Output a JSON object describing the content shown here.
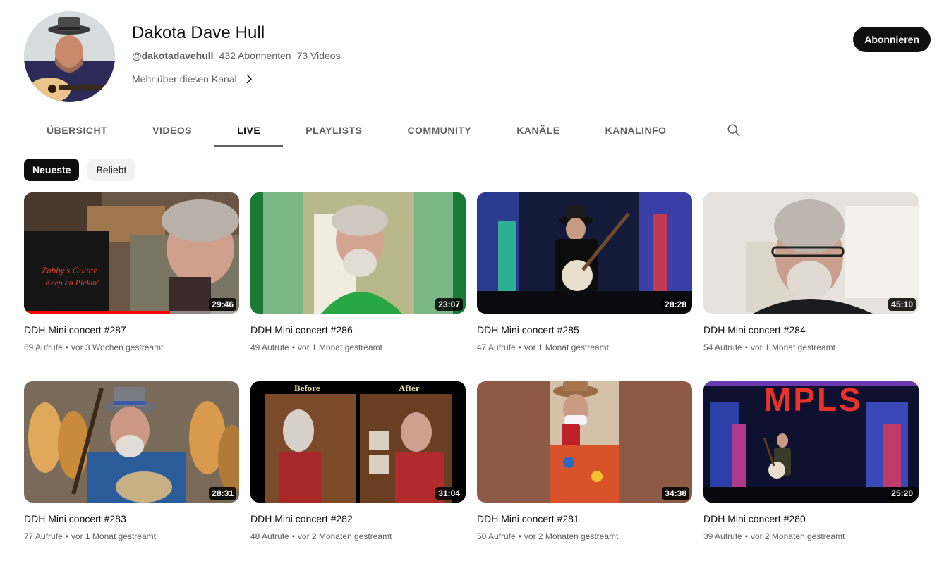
{
  "channel": {
    "name": "Dakota Dave Hull",
    "handle": "@dakotadavehull",
    "subscribers": "432 Abonnenten",
    "videos": "73 Videos",
    "more_label": "Mehr über diesen Kanal",
    "subscribe_label": "Abonnieren"
  },
  "tabs": [
    {
      "label": "Übersicht",
      "active": false
    },
    {
      "label": "Videos",
      "active": false
    },
    {
      "label": "Live",
      "active": true
    },
    {
      "label": "Playlists",
      "active": false
    },
    {
      "label": "Community",
      "active": false
    },
    {
      "label": "Kanäle",
      "active": false
    },
    {
      "label": "Kanalinfo",
      "active": false
    }
  ],
  "chips": {
    "newest": "Neueste",
    "popular": "Beliebt"
  },
  "meta_separator": "•",
  "videos": [
    {
      "title": "DDH Mini concert #287",
      "views": "69 Aufrufe",
      "age": "vor 3 Wochen gestreamt",
      "duration": "29:46",
      "watched_fraction": 0.68
    },
    {
      "title": "DDH Mini concert #286",
      "views": "49 Aufrufe",
      "age": "vor 1 Monat gestreamt",
      "duration": "23:07"
    },
    {
      "title": "DDH Mini concert #285",
      "views": "47 Aufrufe",
      "age": "vor 1 Monat gestreamt",
      "duration": "28:28"
    },
    {
      "title": "DDH Mini concert #284",
      "views": "54 Aufrufe",
      "age": "vor 1 Monat gestreamt",
      "duration": "45:10"
    },
    {
      "title": "DDH Mini concert #283",
      "views": "77 Aufrufe",
      "age": "vor 1 Monat gestreamt",
      "duration": "28:31"
    },
    {
      "title": "DDH Mini concert #282",
      "views": "48 Aufrufe",
      "age": "vor 2 Monaten gestreamt",
      "duration": "31:04",
      "overlay_left": "Before",
      "overlay_right": "After"
    },
    {
      "title": "DDH Mini concert #281",
      "views": "50 Aufrufe",
      "age": "vor 2 Monaten gestreamt",
      "duration": "34:38"
    },
    {
      "title": "DDH Mini concert #280",
      "views": "39 Aufrufe",
      "age": "vor 2 Monaten gestreamt",
      "duration": "25:20",
      "overlay_sign": "MPLS"
    }
  ],
  "colors": {
    "accent": "#0f0f0f",
    "secondary_text": "#606060",
    "progress": "#ff0000"
  }
}
